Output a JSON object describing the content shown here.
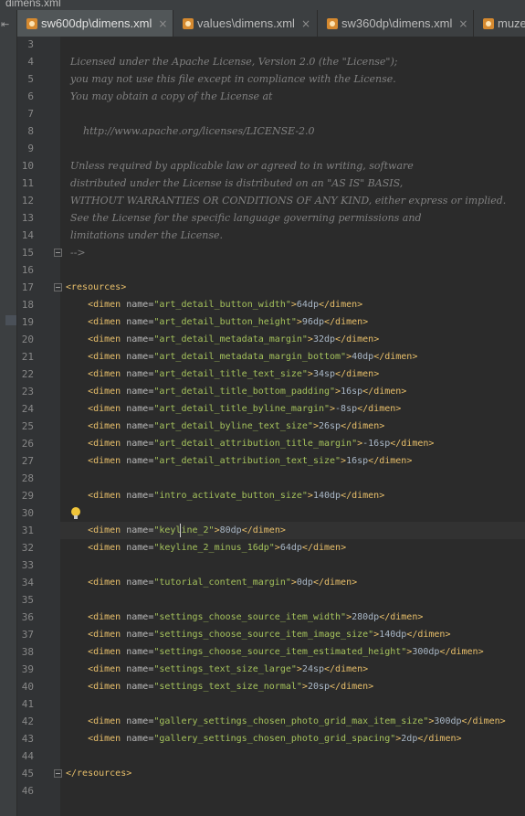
{
  "breadcrumb": {
    "file": "dimens.xml"
  },
  "tabs": [
    {
      "label": "sw600dp\\dimens.xml",
      "active": true,
      "closable": true
    },
    {
      "label": "values\\dimens.xml",
      "active": false,
      "closable": true
    },
    {
      "label": "sw360dp\\dimens.xml",
      "active": false,
      "closable": true
    },
    {
      "label": "muze",
      "active": false,
      "closable": false
    }
  ],
  "tab_close_glyph": "×",
  "colors": {
    "background": "#2b2b2b",
    "gutter": "#313335",
    "tag": "#e8bf6a",
    "attribute_value": "#a5c25c",
    "comment": "#808080",
    "line_number": "#878787"
  },
  "caret_line": 31,
  "intention_bulb_line": 30,
  "code_lines": [
    {
      "n": 3,
      "segs": []
    },
    {
      "n": 4,
      "segs": [
        {
          "t": "c",
          "s": "Licensed under the Apache License, Version 2.0 (the \"License\");"
        }
      ]
    },
    {
      "n": 5,
      "segs": [
        {
          "t": "c",
          "s": "you may not use this file except in compliance with the License."
        }
      ]
    },
    {
      "n": 6,
      "segs": [
        {
          "t": "c",
          "s": "You may obtain a copy of the License at"
        }
      ]
    },
    {
      "n": 7,
      "segs": []
    },
    {
      "n": 8,
      "segs": [
        {
          "t": "c",
          "s": "    http://www.apache.org/licenses/LICENSE-2.0"
        }
      ]
    },
    {
      "n": 9,
      "segs": []
    },
    {
      "n": 10,
      "segs": [
        {
          "t": "c",
          "s": "Unless required by applicable law or agreed to in writing, software"
        }
      ]
    },
    {
      "n": 11,
      "segs": [
        {
          "t": "c",
          "s": "distributed under the License is distributed on an \"AS IS\" BASIS,"
        }
      ]
    },
    {
      "n": 12,
      "segs": [
        {
          "t": "c",
          "s": "WITHOUT WARRANTIES OR CONDITIONS OF ANY KIND, either express or implied."
        }
      ]
    },
    {
      "n": 13,
      "segs": [
        {
          "t": "c",
          "s": "See the License for the specific language governing permissions and"
        }
      ]
    },
    {
      "n": 14,
      "segs": [
        {
          "t": "c",
          "s": "limitations under the License."
        }
      ]
    },
    {
      "n": 15,
      "segs": [
        {
          "t": "c",
          "s": "-->"
        }
      ],
      "fold": true
    },
    {
      "n": 16,
      "segs": []
    },
    {
      "n": 17,
      "segs": [
        {
          "t": "g",
          "s": "<resources>"
        }
      ],
      "fold": true
    },
    {
      "n": 18,
      "segs": [
        {
          "t": "g",
          "s": "    <dimen "
        },
        {
          "t": "a",
          "s": "name="
        },
        {
          "t": "v",
          "s": "\"art_detail_button_width\""
        },
        {
          "t": "g",
          "s": ">"
        },
        {
          "t": "x",
          "s": "64dp"
        },
        {
          "t": "g",
          "s": "</dimen>"
        }
      ]
    },
    {
      "n": 19,
      "segs": [
        {
          "t": "g",
          "s": "    <dimen "
        },
        {
          "t": "a",
          "s": "name="
        },
        {
          "t": "v",
          "s": "\"art_detail_button_height\""
        },
        {
          "t": "g",
          "s": ">"
        },
        {
          "t": "x",
          "s": "96dp"
        },
        {
          "t": "g",
          "s": "</dimen>"
        }
      ]
    },
    {
      "n": 20,
      "segs": [
        {
          "t": "g",
          "s": "    <dimen "
        },
        {
          "t": "a",
          "s": "name="
        },
        {
          "t": "v",
          "s": "\"art_detail_metadata_margin\""
        },
        {
          "t": "g",
          "s": ">"
        },
        {
          "t": "x",
          "s": "32dp"
        },
        {
          "t": "g",
          "s": "</dimen>"
        }
      ]
    },
    {
      "n": 21,
      "segs": [
        {
          "t": "g",
          "s": "    <dimen "
        },
        {
          "t": "a",
          "s": "name="
        },
        {
          "t": "v",
          "s": "\"art_detail_metadata_margin_bottom\""
        },
        {
          "t": "g",
          "s": ">"
        },
        {
          "t": "x",
          "s": "40dp"
        },
        {
          "t": "g",
          "s": "</dimen>"
        }
      ]
    },
    {
      "n": 22,
      "segs": [
        {
          "t": "g",
          "s": "    <dimen "
        },
        {
          "t": "a",
          "s": "name="
        },
        {
          "t": "v",
          "s": "\"art_detail_title_text_size\""
        },
        {
          "t": "g",
          "s": ">"
        },
        {
          "t": "x",
          "s": "34sp"
        },
        {
          "t": "g",
          "s": "</dimen>"
        }
      ]
    },
    {
      "n": 23,
      "segs": [
        {
          "t": "g",
          "s": "    <dimen "
        },
        {
          "t": "a",
          "s": "name="
        },
        {
          "t": "v",
          "s": "\"art_detail_title_bottom_padding\""
        },
        {
          "t": "g",
          "s": ">"
        },
        {
          "t": "x",
          "s": "16sp"
        },
        {
          "t": "g",
          "s": "</dimen>"
        }
      ]
    },
    {
      "n": 24,
      "segs": [
        {
          "t": "g",
          "s": "    <dimen "
        },
        {
          "t": "a",
          "s": "name="
        },
        {
          "t": "v",
          "s": "\"art_detail_title_byline_margin\""
        },
        {
          "t": "g",
          "s": ">"
        },
        {
          "t": "x",
          "s": "-8sp"
        },
        {
          "t": "g",
          "s": "</dimen>"
        }
      ]
    },
    {
      "n": 25,
      "segs": [
        {
          "t": "g",
          "s": "    <dimen "
        },
        {
          "t": "a",
          "s": "name="
        },
        {
          "t": "v",
          "s": "\"art_detail_byline_text_size\""
        },
        {
          "t": "g",
          "s": ">"
        },
        {
          "t": "x",
          "s": "26sp"
        },
        {
          "t": "g",
          "s": "</dimen>"
        }
      ]
    },
    {
      "n": 26,
      "segs": [
        {
          "t": "g",
          "s": "    <dimen "
        },
        {
          "t": "a",
          "s": "name="
        },
        {
          "t": "v",
          "s": "\"art_detail_attribution_title_margin\""
        },
        {
          "t": "g",
          "s": ">"
        },
        {
          "t": "x",
          "s": "-16sp"
        },
        {
          "t": "g",
          "s": "</dimen>"
        }
      ]
    },
    {
      "n": 27,
      "segs": [
        {
          "t": "g",
          "s": "    <dimen "
        },
        {
          "t": "a",
          "s": "name="
        },
        {
          "t": "v",
          "s": "\"art_detail_attribution_text_size\""
        },
        {
          "t": "g",
          "s": ">"
        },
        {
          "t": "x",
          "s": "16sp"
        },
        {
          "t": "g",
          "s": "</dimen>"
        }
      ]
    },
    {
      "n": 28,
      "segs": []
    },
    {
      "n": 29,
      "segs": [
        {
          "t": "g",
          "s": "    <dimen "
        },
        {
          "t": "a",
          "s": "name="
        },
        {
          "t": "v",
          "s": "\"intro_activate_button_size\""
        },
        {
          "t": "g",
          "s": ">"
        },
        {
          "t": "x",
          "s": "140dp"
        },
        {
          "t": "g",
          "s": "</dimen>"
        }
      ]
    },
    {
      "n": 30,
      "segs": []
    },
    {
      "n": 31,
      "segs": [
        {
          "t": "g",
          "s": "    <dimen "
        },
        {
          "t": "a",
          "s": "name="
        },
        {
          "t": "v",
          "s": "\"keyline_2\""
        },
        {
          "t": "g",
          "s": ">"
        },
        {
          "t": "x",
          "s": "80dp"
        },
        {
          "t": "g",
          "s": "</dimen>"
        }
      ]
    },
    {
      "n": 32,
      "segs": [
        {
          "t": "g",
          "s": "    <dimen "
        },
        {
          "t": "a",
          "s": "name="
        },
        {
          "t": "v",
          "s": "\"keyline_2_minus_16dp\""
        },
        {
          "t": "g",
          "s": ">"
        },
        {
          "t": "x",
          "s": "64dp"
        },
        {
          "t": "g",
          "s": "</dimen>"
        }
      ]
    },
    {
      "n": 33,
      "segs": []
    },
    {
      "n": 34,
      "segs": [
        {
          "t": "g",
          "s": "    <dimen "
        },
        {
          "t": "a",
          "s": "name="
        },
        {
          "t": "v",
          "s": "\"tutorial_content_margin\""
        },
        {
          "t": "g",
          "s": ">"
        },
        {
          "t": "x",
          "s": "0dp"
        },
        {
          "t": "g",
          "s": "</dimen>"
        }
      ]
    },
    {
      "n": 35,
      "segs": []
    },
    {
      "n": 36,
      "segs": [
        {
          "t": "g",
          "s": "    <dimen "
        },
        {
          "t": "a",
          "s": "name="
        },
        {
          "t": "v",
          "s": "\"settings_choose_source_item_width\""
        },
        {
          "t": "g",
          "s": ">"
        },
        {
          "t": "x",
          "s": "280dp"
        },
        {
          "t": "g",
          "s": "</dimen>"
        }
      ]
    },
    {
      "n": 37,
      "segs": [
        {
          "t": "g",
          "s": "    <dimen "
        },
        {
          "t": "a",
          "s": "name="
        },
        {
          "t": "v",
          "s": "\"settings_choose_source_item_image_size\""
        },
        {
          "t": "g",
          "s": ">"
        },
        {
          "t": "x",
          "s": "140dp"
        },
        {
          "t": "g",
          "s": "</dimen>"
        }
      ]
    },
    {
      "n": 38,
      "segs": [
        {
          "t": "g",
          "s": "    <dimen "
        },
        {
          "t": "a",
          "s": "name="
        },
        {
          "t": "v",
          "s": "\"settings_choose_source_item_estimated_height\""
        },
        {
          "t": "g",
          "s": ">"
        },
        {
          "t": "x",
          "s": "300dp"
        },
        {
          "t": "g",
          "s": "</dimen>"
        }
      ]
    },
    {
      "n": 39,
      "segs": [
        {
          "t": "g",
          "s": "    <dimen "
        },
        {
          "t": "a",
          "s": "name="
        },
        {
          "t": "v",
          "s": "\"settings_text_size_large\""
        },
        {
          "t": "g",
          "s": ">"
        },
        {
          "t": "x",
          "s": "24sp"
        },
        {
          "t": "g",
          "s": "</dimen>"
        }
      ]
    },
    {
      "n": 40,
      "segs": [
        {
          "t": "g",
          "s": "    <dimen "
        },
        {
          "t": "a",
          "s": "name="
        },
        {
          "t": "v",
          "s": "\"settings_text_size_normal\""
        },
        {
          "t": "g",
          "s": ">"
        },
        {
          "t": "x",
          "s": "20sp"
        },
        {
          "t": "g",
          "s": "</dimen>"
        }
      ]
    },
    {
      "n": 41,
      "segs": []
    },
    {
      "n": 42,
      "segs": [
        {
          "t": "g",
          "s": "    <dimen "
        },
        {
          "t": "a",
          "s": "name="
        },
        {
          "t": "v",
          "s": "\"gallery_settings_chosen_photo_grid_max_item_size\""
        },
        {
          "t": "g",
          "s": ">"
        },
        {
          "t": "x",
          "s": "300dp"
        },
        {
          "t": "g",
          "s": "</dimen>"
        }
      ]
    },
    {
      "n": 43,
      "segs": [
        {
          "t": "g",
          "s": "    <dimen "
        },
        {
          "t": "a",
          "s": "name="
        },
        {
          "t": "v",
          "s": "\"gallery_settings_chosen_photo_grid_spacing\""
        },
        {
          "t": "g",
          "s": ">"
        },
        {
          "t": "x",
          "s": "2dp"
        },
        {
          "t": "g",
          "s": "</dimen>"
        }
      ]
    },
    {
      "n": 44,
      "segs": []
    },
    {
      "n": 45,
      "segs": [
        {
          "t": "g",
          "s": "</resources>"
        }
      ],
      "fold": true
    },
    {
      "n": 46,
      "segs": []
    }
  ]
}
